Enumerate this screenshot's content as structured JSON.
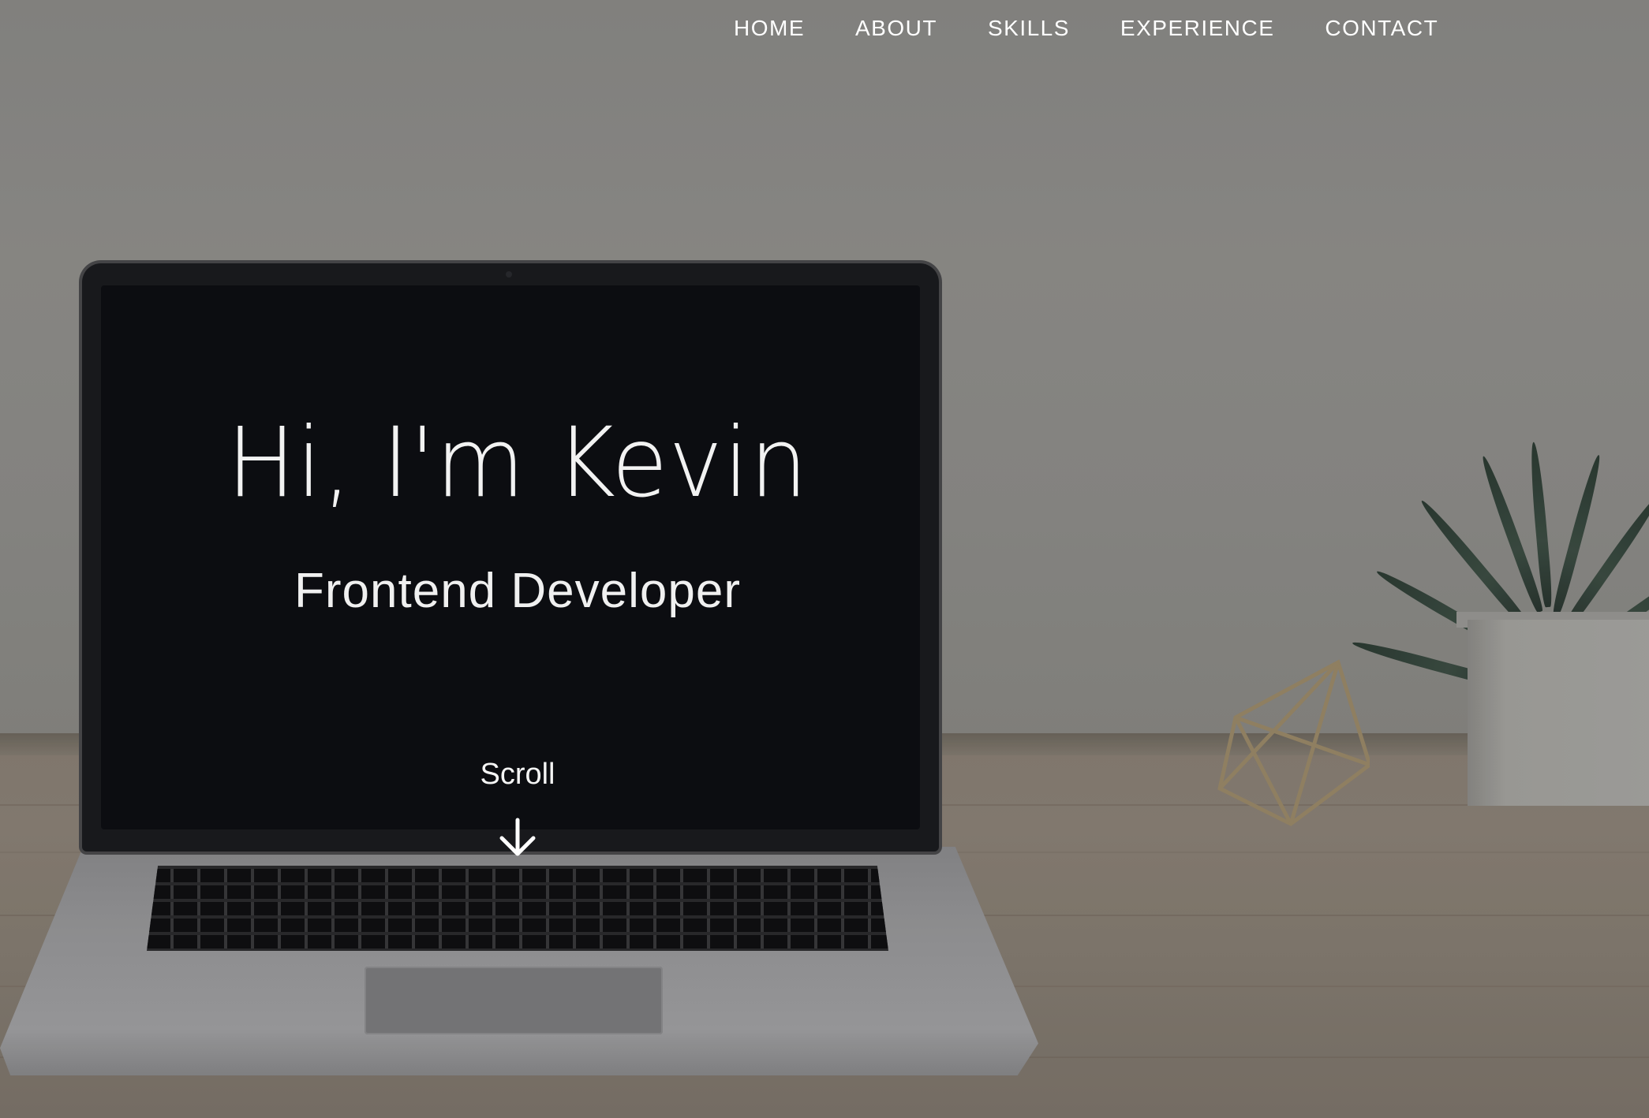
{
  "nav": {
    "items": [
      {
        "label": "HOME"
      },
      {
        "label": "ABOUT"
      },
      {
        "label": "SKILLS"
      },
      {
        "label": "EXPERIENCE"
      },
      {
        "label": "CONTACT"
      }
    ]
  },
  "hero": {
    "title": "Hi, I'm Kevin",
    "subtitle": "Frontend Developer",
    "scroll_label": "Scroll",
    "scroll_icon": "arrow-down-icon"
  },
  "colors": {
    "text": "#ffffff",
    "screen": "#0e0f13"
  }
}
